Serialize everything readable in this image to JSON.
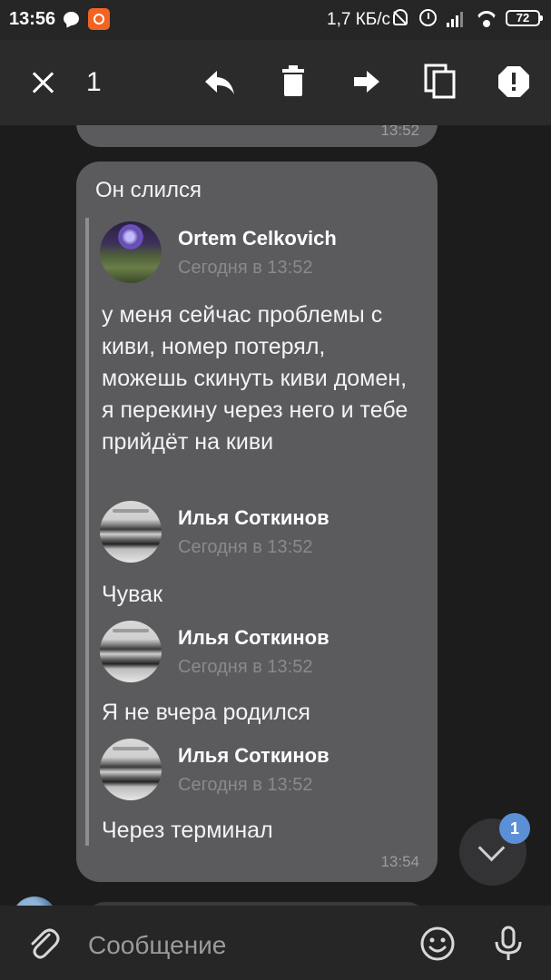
{
  "status_bar": {
    "time": "13:56",
    "speed": "1,7 КБ/с",
    "battery": "72"
  },
  "action_bar": {
    "selected_count": "1",
    "icons": [
      "close-icon",
      "reply-icon",
      "delete-icon",
      "forward-icon",
      "copy-icon",
      "report-icon"
    ]
  },
  "messages": {
    "prev_time": "13:52",
    "main": {
      "caption": "Он слился",
      "time": "13:54",
      "forwarded": [
        {
          "author": "Ortem Celkovich",
          "date": "Сегодня в 13:52",
          "text": "у меня сейчас проблемы с киви, номер потерял, можешь скинуть киви домен, я перекину через него и тебе прийдёт на киви"
        },
        {
          "author": "Илья Соткинов",
          "date": "Сегодня в 13:52",
          "text": "Чувак"
        },
        {
          "author": "Илья Соткинов",
          "date": "Сегодня в 13:52",
          "text": "Я не вчера родился"
        },
        {
          "author": "Илья Соткинов",
          "date": "Сегодня в 13:52",
          "text": "Через терминал"
        }
      ]
    }
  },
  "scroll_down": {
    "badge": "1"
  },
  "input": {
    "placeholder": "Сообщение"
  },
  "colors": {
    "background": "#1c1c1c",
    "bar": "#2b2b2b",
    "bubble": "#5b5b5e",
    "badge": "#5b8fd6"
  }
}
